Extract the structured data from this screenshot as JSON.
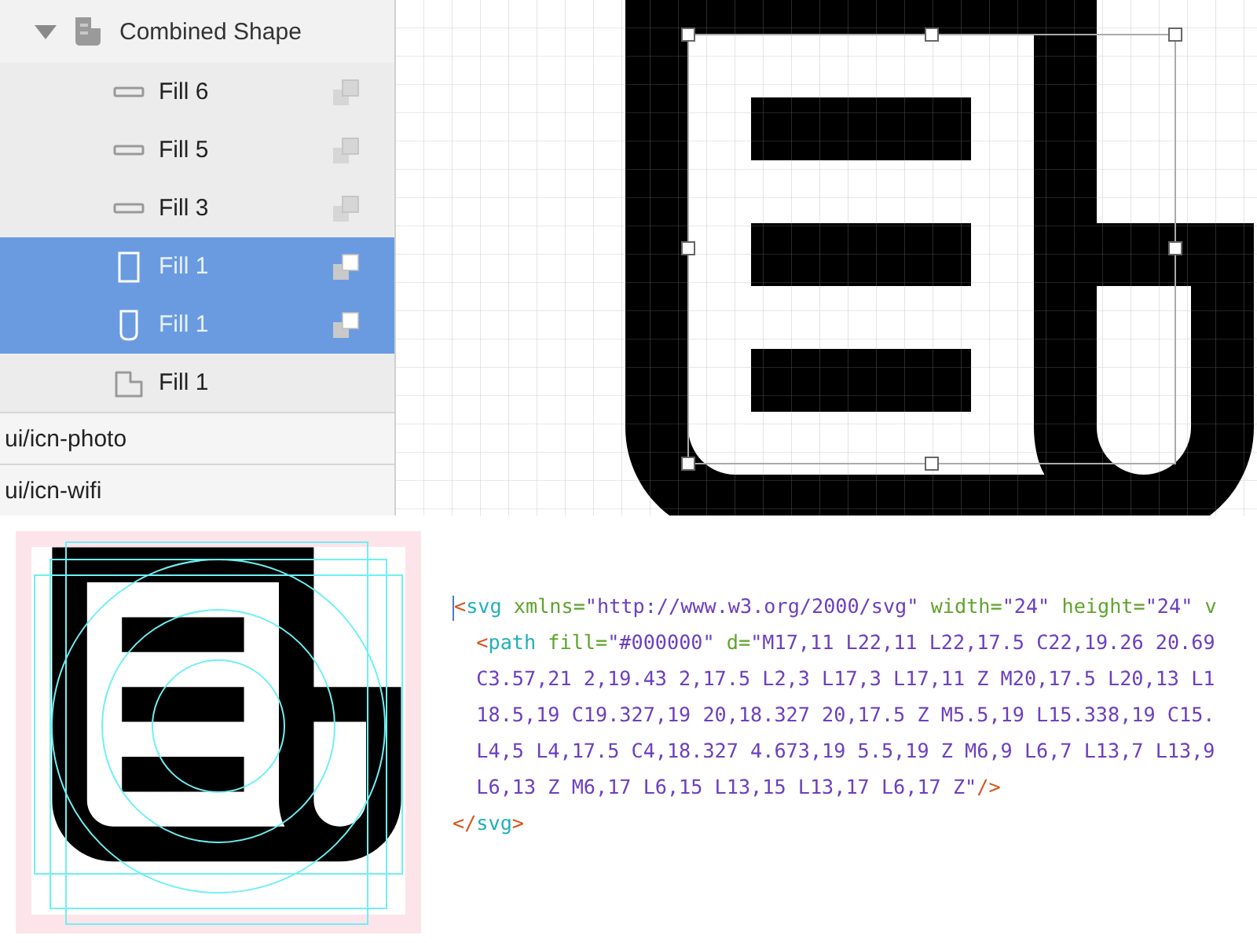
{
  "layers": {
    "group": {
      "name": "Combined Shape",
      "expanded": true,
      "children": [
        {
          "name": "Fill 6",
          "kind": "bar",
          "selected": false,
          "operation": true
        },
        {
          "name": "Fill 5",
          "kind": "bar",
          "selected": false,
          "operation": true
        },
        {
          "name": "Fill 3",
          "kind": "bar",
          "selected": false,
          "operation": true
        },
        {
          "name": "Fill 1",
          "kind": "rect",
          "selected": true,
          "operation": true
        },
        {
          "name": "Fill 1",
          "kind": "pill",
          "selected": true,
          "operation": true
        },
        {
          "name": "Fill 1",
          "kind": "corner",
          "selected": false,
          "operation": false
        }
      ]
    },
    "symbols": [
      {
        "name": "ui/icn-photo"
      },
      {
        "name": "ui/icn-wifi"
      }
    ]
  },
  "code": {
    "lines": [
      [
        {
          "kind": "punct",
          "text": "<"
        },
        {
          "kind": "tag",
          "text": "svg"
        },
        {
          "kind": "attr",
          "text": " xmlns="
        },
        {
          "kind": "string",
          "text": "\"http://www.w3.org/2000/svg\""
        },
        {
          "kind": "attr",
          "text": " width="
        },
        {
          "kind": "string",
          "text": "\"24\""
        },
        {
          "kind": "attr",
          "text": " height="
        },
        {
          "kind": "string",
          "text": "\"24\""
        },
        {
          "kind": "attr",
          "text": " v"
        }
      ],
      [
        {
          "kind": "punct",
          "text": "  <"
        },
        {
          "kind": "tag",
          "text": "path"
        },
        {
          "kind": "attr",
          "text": " fill="
        },
        {
          "kind": "string",
          "text": "\"#000000\""
        },
        {
          "kind": "attr",
          "text": " d="
        },
        {
          "kind": "string",
          "text": "\"M17,11 L22,11 L22,17.5 C22,19.26 20.69"
        }
      ],
      [
        {
          "kind": "string",
          "text": "  C3.57,21 2,19.43 2,17.5 L2,3 L17,3 L17,11 Z M20,17.5 L20,13 L1"
        }
      ],
      [
        {
          "kind": "string",
          "text": "  18.5,19 C19.327,19 20,18.327 20,17.5 Z M5.5,19 L15.338,19 C15."
        }
      ],
      [
        {
          "kind": "string",
          "text": "  L4,5 L4,17.5 C4,18.327 4.673,19 5.5,19 Z M6,9 L6,7 L13,7 L13,9"
        }
      ],
      [
        {
          "kind": "string",
          "text": "  L6,13 Z M6,17 L6,15 L13,15 L13,17 L6,17 Z\""
        },
        {
          "kind": "punct",
          "text": "/>"
        }
      ],
      [
        {
          "kind": "punct",
          "text": "</"
        },
        {
          "kind": "tag",
          "text": "svg"
        },
        {
          "kind": "punct",
          "text": ">"
        }
      ]
    ]
  }
}
